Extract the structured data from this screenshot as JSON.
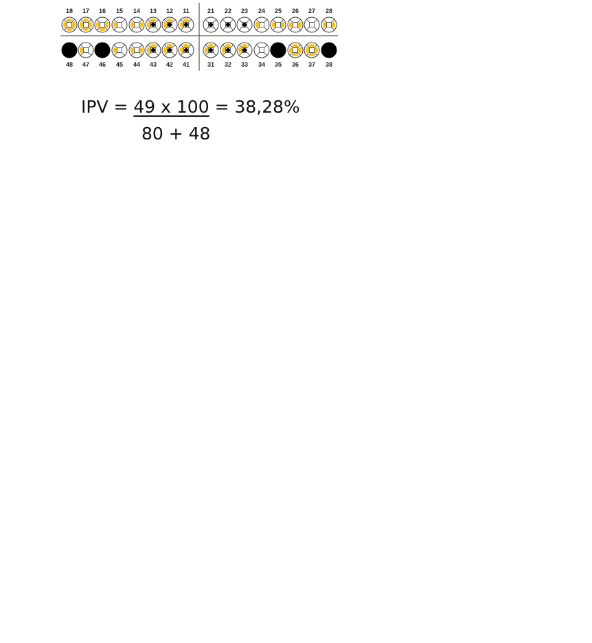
{
  "chart": {
    "upper_right_teeth": [
      "18",
      "17",
      "16",
      "15",
      "14",
      "13",
      "12",
      "11"
    ],
    "upper_left_teeth": [
      "21",
      "22",
      "23",
      "24",
      "25",
      "26",
      "27",
      "28"
    ],
    "lower_right_teeth": [
      "48",
      "47",
      "46",
      "45",
      "44",
      "43",
      "42",
      "41"
    ],
    "lower_left_teeth": [
      "31",
      "32",
      "33",
      "34",
      "35",
      "36",
      "37",
      "38"
    ],
    "legend_note": "",
    "status_by_tooth": {
      "18": "yellow-full",
      "17": "yellow-full",
      "16": "yellow-some",
      "15": "yellow-one",
      "14": "yellow-two",
      "13": "black-yellow",
      "12": "black-yellow",
      "11": "black-yellow",
      "21": "black",
      "22": "black",
      "23": "black",
      "24": "yellow-one",
      "25": "yellow-two",
      "26": "yellow-two",
      "27": "empty",
      "28": "yellow-two",
      "48": "missing",
      "47": "yellow-one",
      "46": "missing",
      "45": "yellow-one",
      "44": "yellow-two",
      "43": "black-yellow",
      "42": "black-yellow",
      "41": "black-yellow",
      "31": "black-yellow",
      "32": "black-yellow",
      "33": "black-yellow",
      "34": "empty",
      "35": "missing",
      "36": "yellow-full",
      "37": "yellow-full",
      "38": "missing"
    },
    "colors": {
      "plaque": "#f6c21a",
      "bleeding": "#000000",
      "missing": "#000000",
      "outline": "#3a3a3a",
      "divider": "#333333"
    }
  },
  "formula": {
    "prefix": "IPV =",
    "numerator": "49 x 100",
    "result": "= 38,28%",
    "denominator": "80 + 48"
  }
}
